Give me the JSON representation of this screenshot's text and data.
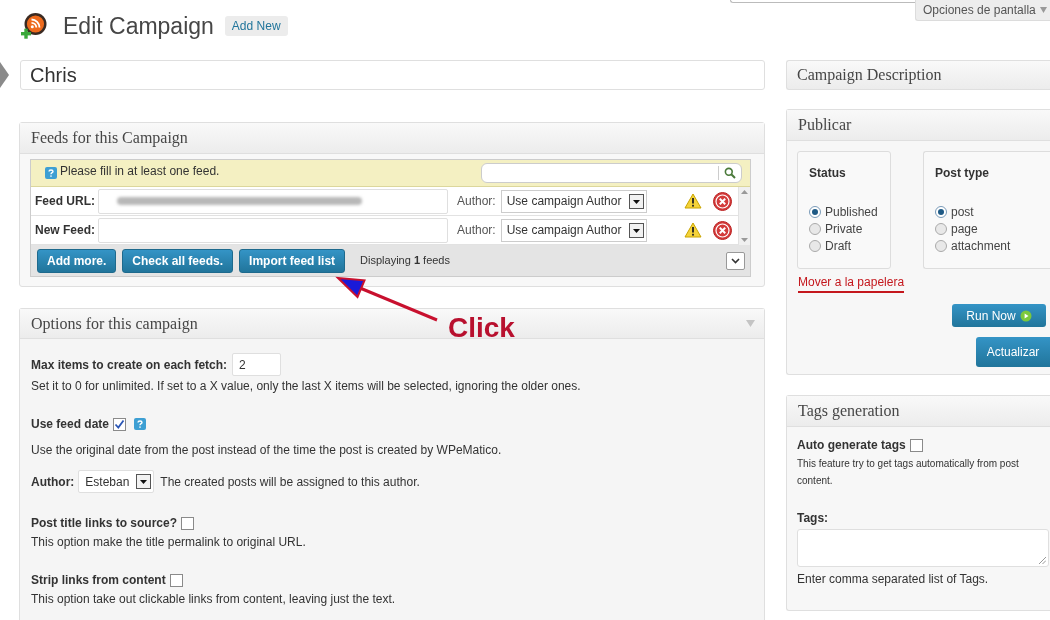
{
  "screen_options": {
    "label": "Opciones de pantalla"
  },
  "page_header": {
    "title": "Edit Campaign",
    "add_new": "Add New"
  },
  "title_field": {
    "value": "Chris"
  },
  "feeds": {
    "title": "Feeds for this Campaign",
    "notice": "Please fill in at least one feed.",
    "rows": [
      {
        "label": "Feed URL:",
        "url_blurred": true,
        "author_label": "Author:",
        "author": "Use campaign Author"
      },
      {
        "label": "New Feed:",
        "url_blurred": false,
        "author_label": "Author:",
        "author": "Use campaign Author"
      }
    ],
    "buttons": [
      "Add more.",
      "Check all feeds.",
      "Import feed list"
    ],
    "count_text": "Displaying **1** feeds"
  },
  "options": {
    "title": "Options for this campaign",
    "items": [
      {
        "kind": "number",
        "label": "Max items to create on each fetch:",
        "value": "2",
        "help": "Set it to 0 for unlimited. If set to a X value, only the last X items will be selected, ignoring the older ones."
      },
      {
        "kind": "checkbox",
        "label": "Use feed date",
        "checked": true,
        "help_icon": true,
        "help": "Use the original date from the post instead of the time the post is created by WPeMatico."
      },
      {
        "kind": "select",
        "label": "Author:",
        "value": "Esteban",
        "help": "The created posts will be assigned to this author."
      },
      {
        "kind": "checkbox",
        "label": "Post title links to source?",
        "checked": false,
        "help_icon": false,
        "help": "This option make the title permalink to original URL."
      },
      {
        "kind": "checkbox",
        "label": "Strip links from content",
        "checked": false,
        "help_icon": false,
        "help": "This option take out clickable links from content, leaving just the text."
      }
    ]
  },
  "sidebar": {
    "description": {
      "title": "Campaign Description"
    },
    "publish": {
      "title": "Publicar",
      "groups": [
        {
          "title": "Status",
          "options": [
            {
              "label": "Published",
              "selected": true
            },
            {
              "label": "Private",
              "selected": false
            },
            {
              "label": "Draft",
              "selected": false
            }
          ]
        },
        {
          "title": "Post type",
          "options": [
            {
              "label": "post",
              "selected": true
            },
            {
              "label": "page",
              "selected": false
            },
            {
              "label": "attachment",
              "selected": false
            }
          ]
        }
      ],
      "trash_link": "Mover a la papelera",
      "run_now": "Run Now",
      "update": "Actualizar"
    },
    "tags": {
      "title": "Tags generation",
      "auto_label": "Auto generate tags",
      "auto_checked": false,
      "auto_help": "This feature try to get tags automatically from post content.",
      "tags_label": "Tags:",
      "tags_help": "Enter comma separated list of Tags."
    }
  },
  "annotation": {
    "text": "Click"
  }
}
